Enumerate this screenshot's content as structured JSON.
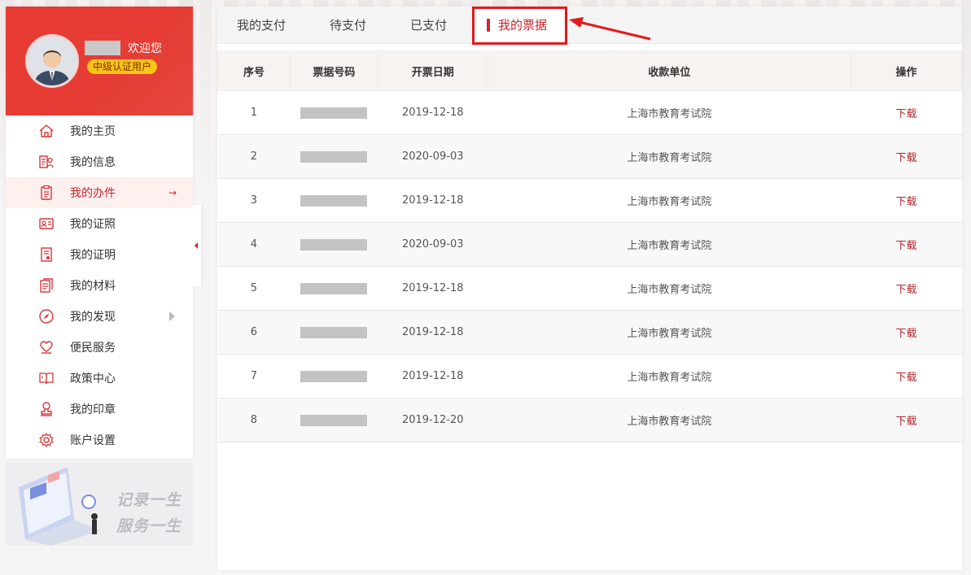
{
  "profile": {
    "welcome": "欢迎您",
    "level_badge": "中级认证用户"
  },
  "sidebar": {
    "items": [
      {
        "label": "我的主页",
        "icon": "home-icon"
      },
      {
        "label": "我的信息",
        "icon": "user-info-icon"
      },
      {
        "label": "我的办件",
        "icon": "clipboard-icon",
        "active": true
      },
      {
        "label": "我的证照",
        "icon": "id-card-icon"
      },
      {
        "label": "我的证明",
        "icon": "certificate-icon"
      },
      {
        "label": "我的材料",
        "icon": "documents-icon"
      },
      {
        "label": "我的发现",
        "icon": "compass-icon"
      },
      {
        "label": "便民服务",
        "icon": "heart-hand-icon"
      },
      {
        "label": "政策中心",
        "icon": "book-icon"
      },
      {
        "label": "我的印章",
        "icon": "stamp-icon"
      },
      {
        "label": "账户设置",
        "icon": "gear-icon"
      }
    ]
  },
  "promo": {
    "line1": "记录一生",
    "line2": "服务一生"
  },
  "tabs": [
    {
      "label": "我的支付"
    },
    {
      "label": "待支付"
    },
    {
      "label": "已支付"
    },
    {
      "label": "我的票据",
      "active": true
    }
  ],
  "table": {
    "columns": [
      "序号",
      "票据号码",
      "开票日期",
      "收款单位",
      "操作"
    ],
    "rows": [
      {
        "index": "1",
        "date": "2019-12-18",
        "payee": "上海市教育考试院",
        "action": "下载"
      },
      {
        "index": "2",
        "date": "2020-09-03",
        "payee": "上海市教育考试院",
        "action": "下载"
      },
      {
        "index": "3",
        "date": "2019-12-18",
        "payee": "上海市教育考试院",
        "action": "下载"
      },
      {
        "index": "4",
        "date": "2020-09-03",
        "payee": "上海市教育考试院",
        "action": "下载"
      },
      {
        "index": "5",
        "date": "2019-12-18",
        "payee": "上海市教育考试院",
        "action": "下载"
      },
      {
        "index": "6",
        "date": "2019-12-18",
        "payee": "上海市教育考试院",
        "action": "下载"
      },
      {
        "index": "7",
        "date": "2019-12-18",
        "payee": "上海市教育考试院",
        "action": "下载"
      },
      {
        "index": "8",
        "date": "2019-12-20",
        "payee": "上海市教育考试院",
        "action": "下载"
      }
    ]
  },
  "colors": {
    "brand_red": "#e83a33",
    "accent_red": "#c8262b",
    "badge_yellow": "#f5c518",
    "annotation_red": "#e3191e"
  }
}
